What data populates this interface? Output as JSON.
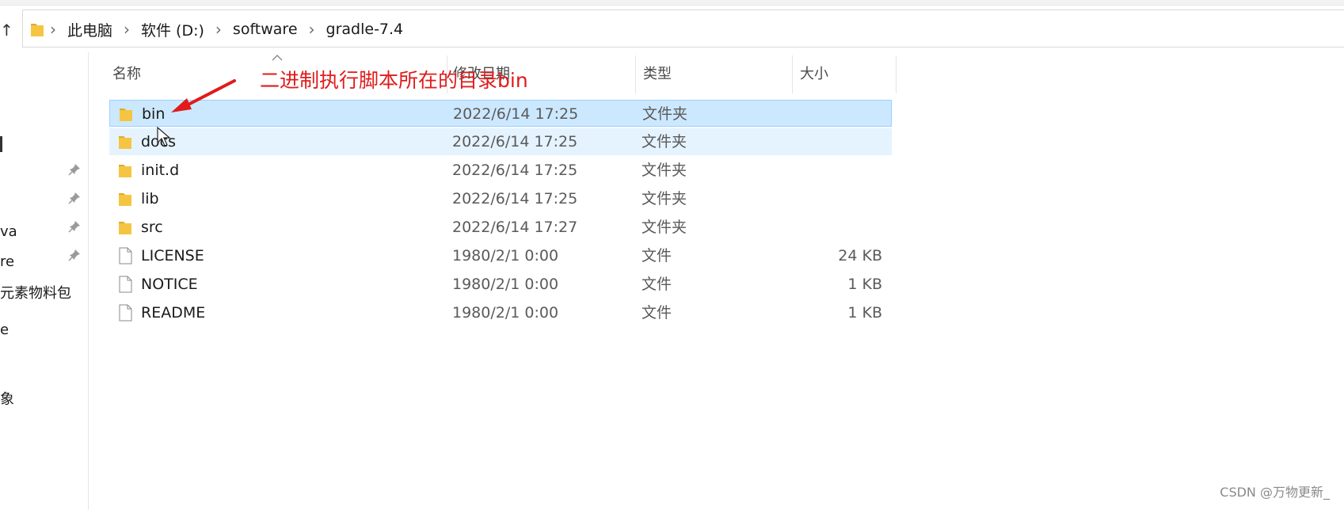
{
  "window": {
    "up_button": "↑"
  },
  "breadcrumb": [
    "此电脑",
    "软件 (D:)",
    "software",
    "gradle-7.4"
  ],
  "nav_pane": {
    "items": [
      "va",
      "re",
      "元素物料包",
      "e",
      "象"
    ]
  },
  "columns": {
    "name": "名称",
    "modified": "修改日期",
    "type": "类型",
    "size": "大小"
  },
  "files": [
    {
      "name": "bin",
      "modified": "2022/6/14 17:25",
      "type": "文件夹",
      "size": "",
      "kind": "folder",
      "state": "selected"
    },
    {
      "name": "docs",
      "modified": "2022/6/14 17:25",
      "type": "文件夹",
      "size": "",
      "kind": "folder",
      "state": "hover"
    },
    {
      "name": "init.d",
      "modified": "2022/6/14 17:25",
      "type": "文件夹",
      "size": "",
      "kind": "folder",
      "state": "normal"
    },
    {
      "name": "lib",
      "modified": "2022/6/14 17:25",
      "type": "文件夹",
      "size": "",
      "kind": "folder",
      "state": "normal"
    },
    {
      "name": "src",
      "modified": "2022/6/14 17:27",
      "type": "文件夹",
      "size": "",
      "kind": "folder",
      "state": "normal"
    },
    {
      "name": "LICENSE",
      "modified": "1980/2/1 0:00",
      "type": "文件",
      "size": "24 KB",
      "kind": "file",
      "state": "normal"
    },
    {
      "name": "NOTICE",
      "modified": "1980/2/1 0:00",
      "type": "文件",
      "size": "1 KB",
      "kind": "file",
      "state": "normal"
    },
    {
      "name": "README",
      "modified": "1980/2/1 0:00",
      "type": "文件",
      "size": "1 KB",
      "kind": "file",
      "state": "normal"
    }
  ],
  "annotation": {
    "text": "二进制执行脚本所在的目录bin",
    "color": "#e01b1b"
  },
  "watermark": "CSDN @万物更新_",
  "colors": {
    "selection": "#cce8ff",
    "selection_border": "#99d1ff",
    "hover": "#e5f3ff",
    "folder": "#f5c542"
  }
}
